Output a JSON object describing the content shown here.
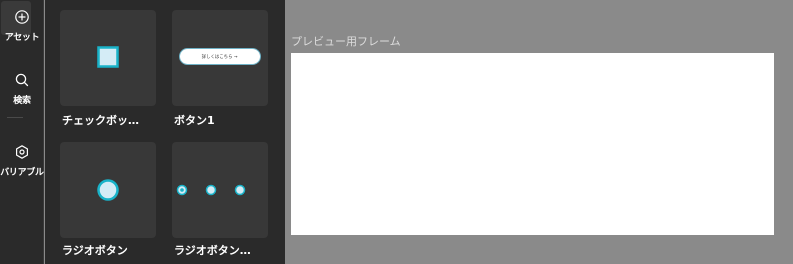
{
  "rail": {
    "items": [
      {
        "label": "アセット",
        "icon": "add-circle-icon"
      },
      {
        "label": "検索",
        "icon": "search-icon"
      },
      {
        "label": "バリアブル",
        "icon": "hexagon-gear-icon"
      }
    ]
  },
  "assets": {
    "cards": [
      {
        "label": "チェックボッ…",
        "thumbnail": "checkbox"
      },
      {
        "label": "ボタン1",
        "thumbnail": "button",
        "button_text": "詳しくはこちら →"
      },
      {
        "label": "ラジオボタン",
        "thumbnail": "radio"
      },
      {
        "label": "ラジオボタン…",
        "thumbnail": "radio-group"
      }
    ]
  },
  "preview": {
    "title": "プレビュー用フレーム"
  },
  "colors": {
    "accent": "#19b3c9",
    "control_fill": "#d4ecf6"
  }
}
